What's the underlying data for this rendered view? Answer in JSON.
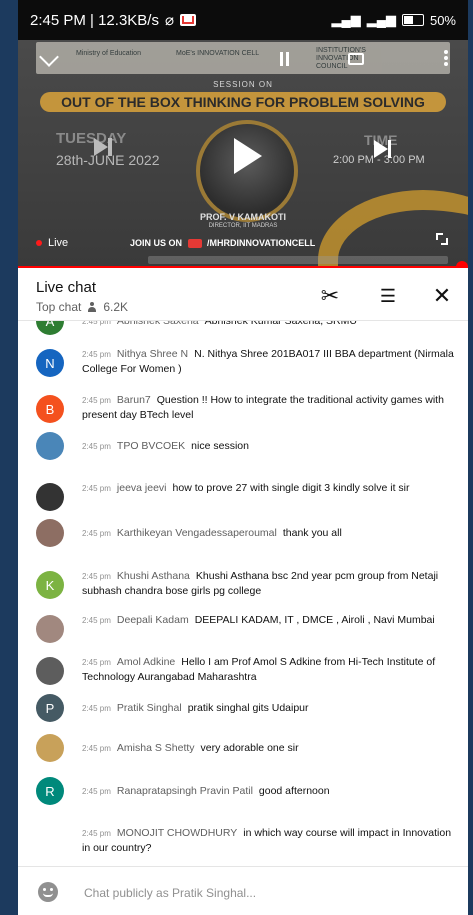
{
  "status_bar": {
    "time_speed": "2:45 PM | 12.3KB/s",
    "battery": "50%"
  },
  "video": {
    "session_on": "SESSION ON",
    "banner_title": "OUT OF THE BOX THINKING FOR PROBLEM SOLVING",
    "day": "TUESDAY",
    "date": "28th-JUNE 2022",
    "time_label": "TIME",
    "time_value": "2:00 PM - 3:00 PM",
    "speaker_name": "PROF. V KAMAKOTI",
    "speaker_title": "DIRECTOR, IIT MADRAS",
    "join_us": "JOIN US ON",
    "channel": "/MHRDINNOVATIONCELL",
    "live_label": "Live",
    "logo_1": "Ministry of Education",
    "logo_2": "MoE's INNOVATION CELL",
    "logo_3": "INSTITUTION'S INNOVATION COUNCIL",
    "progress_fraction": 1.0
  },
  "chat_header": {
    "title": "Live chat",
    "mode": "Top chat",
    "viewers": "6.2K"
  },
  "messages": [
    {
      "avatar_letter": "A",
      "avatar_color": "#2e7d32",
      "time": "2:45 pm",
      "author": "Abhishek Saxena",
      "text": "Abhishek Kumar Saxena, SRMU"
    },
    {
      "avatar_letter": "N",
      "avatar_color": "#1565c0",
      "time": "2:45 pm",
      "author": "Nithya Shree N",
      "text": "N. Nithya Shree 201BA017 III BBA department (Nirmala College For Women )"
    },
    {
      "avatar_letter": "B",
      "avatar_color": "#f4511e",
      "time": "2:45 pm",
      "author": "Barun7",
      "text": "Question !! How to integrate the traditional activity games with present day BTech level"
    },
    {
      "avatar_letter": "",
      "avatar_color": "#4a86b8",
      "time": "2:45 pm",
      "author": "TPO BVCOEK",
      "text": "nice session"
    },
    {
      "avatar_letter": "",
      "avatar_color": "#333333",
      "time": "2:45 pm",
      "author": "jeeva jeevi",
      "text": "how to prove 27 with single digit 3 kindly solve it sir"
    },
    {
      "avatar_letter": "",
      "avatar_color": "#8d6e63",
      "time": "2:45 pm",
      "author": "Karthikeyan Vengadessaperoumal",
      "text": "thank you all"
    },
    {
      "avatar_letter": "K",
      "avatar_color": "#7cb342",
      "time": "2:45 pm",
      "author": "Khushi Asthana",
      "text": "Khushi Asthana bsc 2nd year pcm group from Netaji subhash chandra bose girls pg college"
    },
    {
      "avatar_letter": "",
      "avatar_color": "#a1887f",
      "time": "2:45 pm",
      "author": "Deepali Kadam",
      "text": "DEEPALI KADAM, IT , DMCE , Airoli , Navi Mumbai"
    },
    {
      "avatar_letter": "",
      "avatar_color": "#5d5d5d",
      "time": "2:45 pm",
      "author": "Amol Adkine",
      "text": "Hello I am Prof Amol S Adkine from Hi-Tech Institute of Technology Aurangabad Maharashtra"
    },
    {
      "avatar_letter": "P",
      "avatar_color": "#455a64",
      "time": "2:45 pm",
      "author": "Pratik Singhal",
      "text": "pratik singhal gits Udaipur"
    },
    {
      "avatar_letter": "",
      "avatar_color": "#c8a15a",
      "time": "2:45 pm",
      "author": "Amisha S Shetty",
      "text": "very adorable one sir"
    },
    {
      "avatar_letter": "R",
      "avatar_color": "#00897b",
      "time": "2:45 pm",
      "author": "Ranapratapsingh Pravin Patil",
      "text": "good afternoon"
    },
    {
      "avatar_letter": "",
      "avatar_color": "#ffffff",
      "time": "2:45 pm",
      "author": "MONOJIT CHOWDHURY",
      "text": "in which way course will impact in Innovation in our country?"
    }
  ],
  "input": {
    "placeholder": "Chat publicly as Pratik Singhal..."
  }
}
